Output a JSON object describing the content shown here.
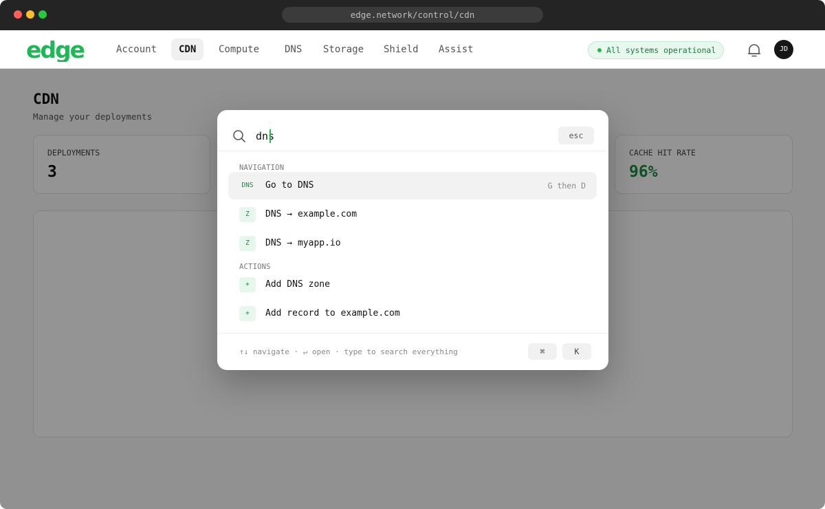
{
  "browser": {
    "url": "edge.network/control/cdn"
  },
  "header": {
    "logo_text": "edge",
    "nav": [
      {
        "label": "Account"
      },
      {
        "label": "CDN"
      },
      {
        "label": "Compute"
      },
      {
        "label": "DNS"
      },
      {
        "label": "Storage"
      },
      {
        "label": "Shield"
      },
      {
        "label": "Assist"
      }
    ],
    "active_nav": "CDN",
    "status": "All systems operational",
    "avatar_initials": "JD"
  },
  "page": {
    "title": "CDN",
    "subtitle": "Manage your deployments",
    "stats": [
      {
        "label": "DEPLOYMENTS",
        "value": "3"
      },
      {
        "label": "CACHE HIT RATE",
        "value": "96%"
      }
    ]
  },
  "palette": {
    "query": "dns",
    "esc_label": "esc",
    "sections": [
      {
        "label": "NAVIGATION",
        "items": [
          {
            "icon": "DNS",
            "label": "Go to DNS",
            "hint": "G then D"
          },
          {
            "icon": "Z",
            "label": "DNS → example.com"
          },
          {
            "icon": "Z",
            "label": "DNS → myapp.io"
          }
        ]
      },
      {
        "label": "ACTIONS",
        "items": [
          {
            "icon": "+",
            "label": "Add DNS zone"
          },
          {
            "icon": "+",
            "label": "Add record to example.com"
          }
        ]
      }
    ],
    "footer_hint": "↑↓ navigate · ↵ open · type to search everything",
    "shortcut_keys": [
      "⌘",
      "K"
    ]
  },
  "colors": {
    "accent": "#20b757",
    "accent_dark": "#1c8c45"
  }
}
